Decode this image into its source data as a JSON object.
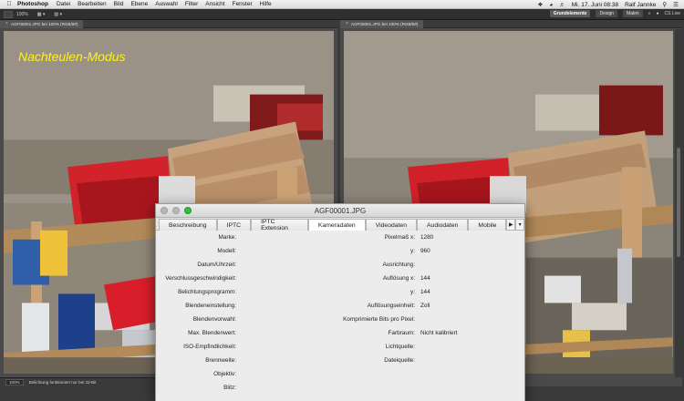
{
  "menubar": {
    "app": "Photoshop",
    "items": [
      "Datei",
      "Bearbeiten",
      "Bild",
      "Ebene",
      "Auswahl",
      "Filter",
      "Ansicht",
      "Fenster",
      "Hilfe"
    ],
    "datetime": "Mi. 17. Juni  08:38",
    "user": "Ralf Jannke",
    "icons": [
      "apple-icon",
      "dropbox-icon",
      "wifi-icon",
      "volume-icon",
      "spotlight-icon",
      "list-icon"
    ]
  },
  "optionsbar": {
    "zoom": "100%",
    "workspace_buttons": [
      "Grundelemente",
      "Design",
      "Malen"
    ],
    "active_workspace": "Grundelemente",
    "more": "»",
    "cs_live": "CS Live"
  },
  "left_doc": {
    "tab_label": "AGF00001.JPG bei 100% (RGB/8#)",
    "overlay_text": "Nachteulen-Modus",
    "status_zoom": "100%",
    "status_text": "Belichtung funktioniert nur bei 32-Bit"
  },
  "right_doc": {
    "tab_label": "AGF00001.JPG bei 100% (RGB/8#)"
  },
  "dialog": {
    "title": "AGF00001.JPG",
    "tabs": [
      "Beschreibung",
      "IPTC",
      "IPTC Extension",
      "Kameradaten",
      "Videodaten",
      "Audiodaten",
      "Mobile"
    ],
    "active_tab": "Kameradaten",
    "left_fields": [
      {
        "label": "Marke:",
        "value": ""
      },
      {
        "label": "Modell:",
        "value": ""
      },
      {
        "label": "Datum/Uhrzeit:",
        "value": ""
      },
      {
        "label": "Verschlussgeschwindigkeit:",
        "value": ""
      },
      {
        "label": "Belichtungsprogramm:",
        "value": ""
      },
      {
        "label": "Blendeneinstellung:",
        "value": ""
      },
      {
        "label": "Blendenvorwahl:",
        "value": ""
      },
      {
        "label": "Max. Blendenwert:",
        "value": ""
      },
      {
        "label": "ISO-Empfindlichkeit:",
        "value": ""
      },
      {
        "label": "Brennweite:",
        "value": ""
      },
      {
        "label": "Objektiv:",
        "value": ""
      },
      {
        "label": "Blitz:",
        "value": ""
      }
    ],
    "right_fields": [
      {
        "label": "Pixelmaß x:",
        "value": "1280"
      },
      {
        "label": "y:",
        "value": "960"
      },
      {
        "label": "Ausrichtung:",
        "value": ""
      },
      {
        "label": "Auflösung x:",
        "value": "144"
      },
      {
        "label": "y:",
        "value": "144"
      },
      {
        "label": "Auflösungseinheit:",
        "value": "Zoll"
      },
      {
        "label": "Komprimierte Bits pro Pixel:",
        "value": ""
      },
      {
        "label": "Farbraum:",
        "value": "Nicht kalibriert"
      },
      {
        "label": "Lichtquelle:",
        "value": ""
      },
      {
        "label": "Dateiquelle:",
        "value": ""
      }
    ]
  },
  "colors": {
    "overlay_text": "#fff21a",
    "ps_dark": "#2f2f2f",
    "dialog_bg": "#ececec",
    "zoom_light": "#2fbf3f"
  }
}
